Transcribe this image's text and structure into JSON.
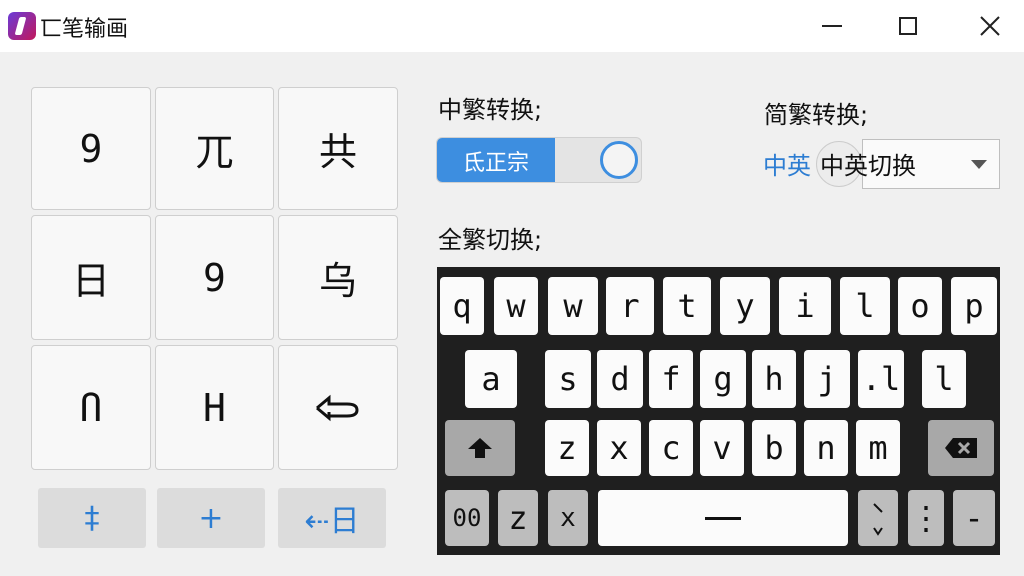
{
  "window": {
    "title": "匸笔输画"
  },
  "left_grid": [
    "9",
    "兀",
    "共",
    "日",
    "9",
    "乌",
    "Ո",
    "H"
  ],
  "bottom_buttons": [
    "‡",
    "+",
    "⇠日"
  ],
  "right": {
    "trad_convert_label": "中繁转换;",
    "toggle_on_label": "氐正宗",
    "simp_trad_label": "简繁转换;",
    "zh_en_prefix": "中英",
    "select_value": "中英切换",
    "full_trad_label": "全繁切换;"
  },
  "keyboard": {
    "row1": [
      "q",
      "w",
      "w",
      "r",
      "t",
      "y",
      "i",
      "l",
      "o",
      "p"
    ],
    "row2": [
      "a",
      "s",
      "d",
      "f",
      "g",
      "h",
      "j",
      ".l",
      "l"
    ],
    "row3": [
      "z",
      "x",
      "c",
      "v",
      "b",
      "n",
      "m"
    ],
    "row4_left": [
      "00",
      "z",
      "x"
    ],
    "row4_right": [
      "⋮",
      "-"
    ]
  }
}
